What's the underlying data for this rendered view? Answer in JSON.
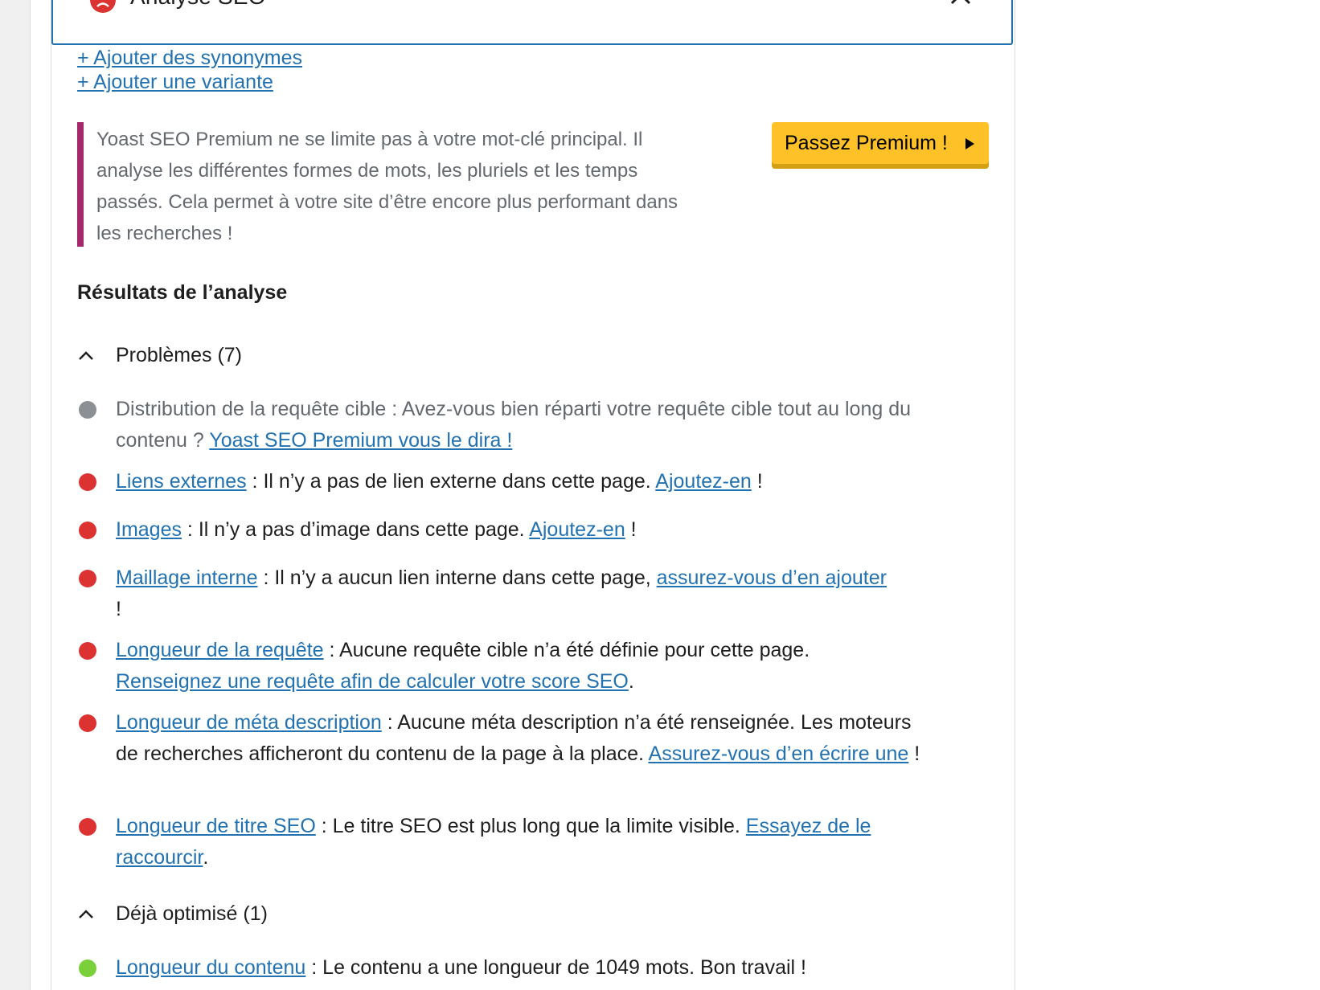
{
  "header": {
    "title": "Analyse SEO"
  },
  "links": {
    "synonyms": "+ Ajouter des synonymes",
    "variant": "+ Ajouter une variante"
  },
  "premium": {
    "text": "Yoast SEO Premium ne se limite pas à votre mot-clé principal. Il analyse les différentes formes de mots, les pluriels et les temps passés. Cela permet à votre site d’être encore plus performant dans les recherches !",
    "button": "Passez Premium !"
  },
  "results": {
    "heading": "Résultats de l’analyse",
    "problems_label": "Problèmes (7)",
    "optimized_label": "Déjà optimisé (1)",
    "items": [
      {
        "status": "grey",
        "pre": "Distribution de la requête cible : Avez-vous bien réparti votre requête cible tout au long du contenu ? ",
        "link": "Yoast SEO Premium vous le dira !",
        "post": ""
      },
      {
        "status": "red",
        "title": "Liens externes",
        "mid": " : Il n’y a pas de lien externe dans cette page. ",
        "link": "Ajoutez-en",
        "post": " !"
      },
      {
        "status": "red",
        "title": "Images",
        "mid": " : Il n’y a pas d’image dans cette page. ",
        "link": "Ajoutez-en",
        "post": " !"
      },
      {
        "status": "red",
        "title": "Maillage interne",
        "mid": " : Il n’y a aucun lien interne dans cette page, ",
        "link": "assurez-vous d’en ajouter",
        "post": " !"
      },
      {
        "status": "red",
        "title": "Longueur de la requête",
        "mid": " : Aucune requête cible n’a été définie pour cette page. ",
        "link": "Renseignez une requête afin de calculer votre score SEO",
        "post": "."
      },
      {
        "status": "red",
        "title": "Longueur de méta description",
        "mid": " : Aucune méta description n’a été renseignée. Les moteurs de recherches afficheront du contenu de la page à la place. ",
        "link": "Assurez-vous d’en écrire une",
        "post": " !"
      },
      {
        "status": "red",
        "title": "Longueur de titre SEO",
        "mid": " : Le titre SEO est plus long que la limite visible. ",
        "link": "Essayez de le raccourcir",
        "post": "."
      },
      {
        "status": "green",
        "title": "Longueur du contenu",
        "mid": " : Le contenu a une longueur de 1049 mots. Bon travail !",
        "link": "",
        "post": ""
      }
    ]
  },
  "colors": {
    "red": "#dc3232",
    "grey": "#8c8f94",
    "green": "#7ad03a",
    "link": "#2271b1",
    "premium_btn": "#fec228",
    "premium_bar": "#a4286a"
  },
  "icons": {
    "header": "sad-face-icon",
    "close": "close-icon",
    "chevron": "chevron-up-icon"
  }
}
